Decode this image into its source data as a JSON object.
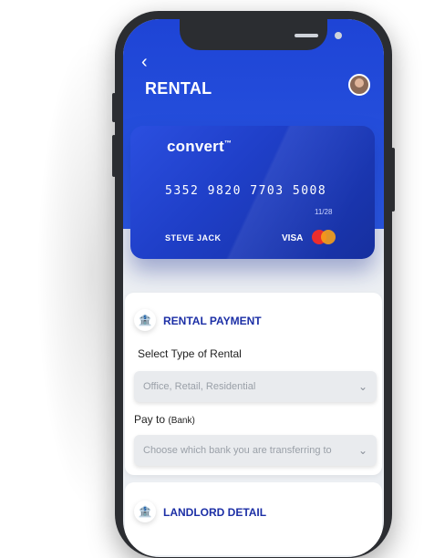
{
  "header": {
    "title": "RENTAL",
    "back_icon": "chevron-left-icon",
    "avatar": "user-avatar"
  },
  "card": {
    "brand": "convert",
    "brand_mark": "™",
    "number": "5352 9820 7703 5008",
    "expiry": "11/28",
    "holder": "STEVE JACK",
    "network": "VISA",
    "colors": {
      "primary": "#1e44d6",
      "mastercard_red": "#eb2d2d",
      "mastercard_orange": "#f6a01a"
    }
  },
  "rental_payment": {
    "title": "RENTAL PAYMENT",
    "type_label": "Select Type of Rental",
    "type_value": "Office, Retail, Residential",
    "payto_label": "Pay to",
    "payto_sub": "(Bank)",
    "bank_placeholder": "Choose which bank you are transferring to"
  },
  "landlord": {
    "title": "LANDLORD DETAIL"
  }
}
